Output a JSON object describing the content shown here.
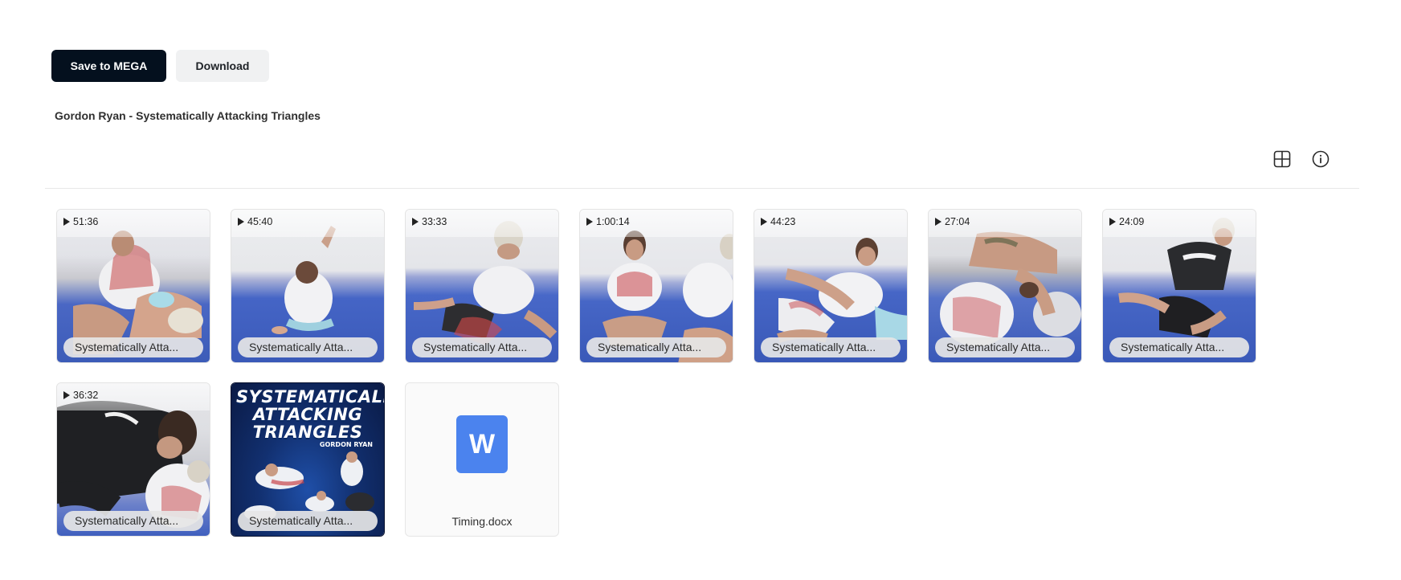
{
  "toolbar": {
    "save_label": "Save to MEGA",
    "download_label": "Download"
  },
  "folder": {
    "title": "Gordon Ryan - Systematically Attacking Triangles"
  },
  "view_controls": {
    "grid_icon": "grid-view-icon",
    "info_icon": "info-icon"
  },
  "items": [
    {
      "type": "video",
      "duration": "51:36",
      "name": "Systematically Atta..."
    },
    {
      "type": "video",
      "duration": "45:40",
      "name": "Systematically Atta..."
    },
    {
      "type": "video",
      "duration": "33:33",
      "name": "Systematically Atta..."
    },
    {
      "type": "video",
      "duration": "1:00:14",
      "name": "Systematically Atta..."
    },
    {
      "type": "video",
      "duration": "44:23",
      "name": "Systematically Atta..."
    },
    {
      "type": "video",
      "duration": "27:04",
      "name": "Systematically Atta..."
    },
    {
      "type": "video",
      "duration": "24:09",
      "name": "Systematically Atta..."
    },
    {
      "type": "video",
      "duration": "36:32",
      "name": "Systematically Atta..."
    },
    {
      "type": "image",
      "name": "Systematically Atta...",
      "cover_title": "SYSTEMATICALLY ATTACKING TRIANGLES",
      "cover_subtitle": "GORDON RYAN"
    },
    {
      "type": "document",
      "name": "Timing.docx",
      "icon_letter": "W"
    }
  ]
}
